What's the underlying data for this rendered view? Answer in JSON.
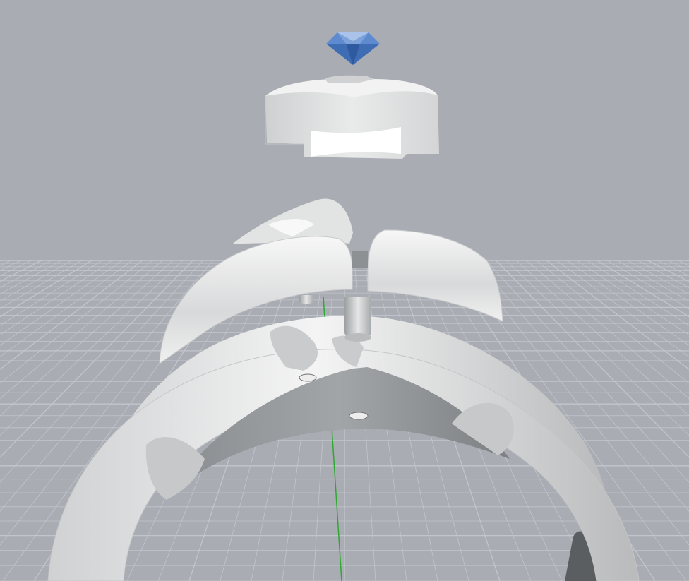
{
  "viewport": {
    "view_type": "perspective",
    "background_color": "#a9adb3",
    "grid_color": "#c2c6cc",
    "grid_visible": true,
    "y_axis_color": "#2fa832"
  },
  "scene": {
    "objects": [
      {
        "name": "gemstone",
        "color": "#4f7fc6"
      },
      {
        "name": "setting-head",
        "color": "#e2e3e3"
      },
      {
        "name": "top-shank-piece",
        "color": "#e6e7e7"
      },
      {
        "name": "ring-band",
        "color": "#dcdede"
      }
    ]
  }
}
